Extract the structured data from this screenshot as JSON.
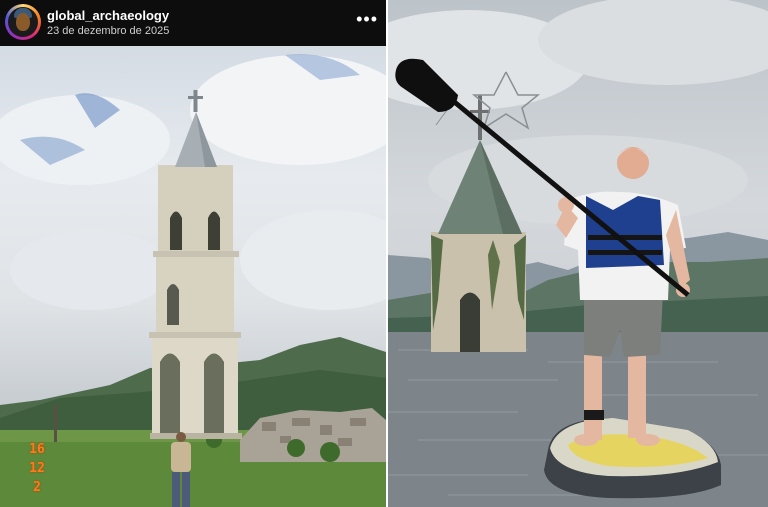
{
  "post": {
    "username": "global_archaeology",
    "date": "23 de dezembro de 2025",
    "more_icon": "more-horizontal-icon",
    "avatar_icon": "profile-avatar"
  },
  "left_photo": {
    "date_stamp": [
      "16",
      "12",
      "2"
    ],
    "stamp_color": "#ff7a1a"
  },
  "right_photo": {
    "board_accent": "#e8d44d",
    "vest_color": "#1f3f8f"
  }
}
